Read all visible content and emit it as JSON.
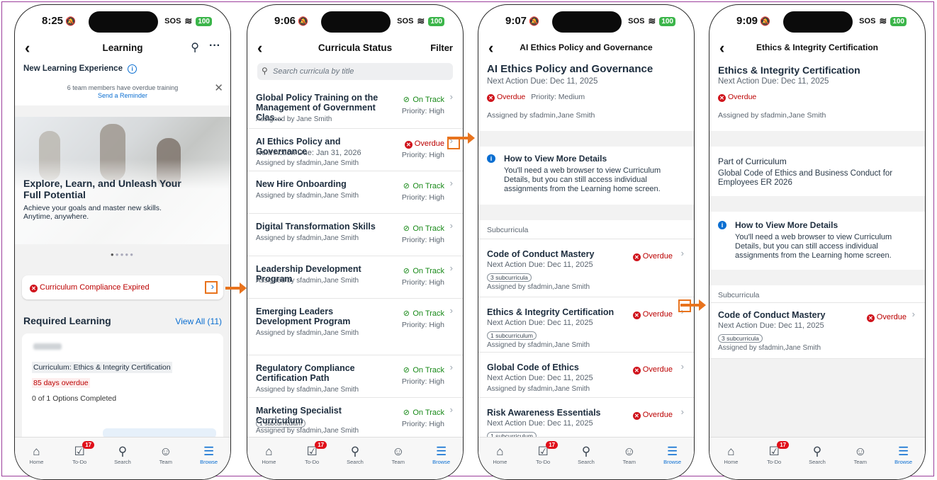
{
  "status": {
    "sos": "SOS",
    "battery": "100"
  },
  "tabs": [
    {
      "label": "Home",
      "icon": "home-icon",
      "glyph": "⌂"
    },
    {
      "label": "To-Do",
      "icon": "todo-icon",
      "glyph": "☑",
      "badge": "17"
    },
    {
      "label": "Search",
      "icon": "search-icon",
      "glyph": "⚲"
    },
    {
      "label": "Team",
      "icon": "team-icon",
      "glyph": "☺"
    },
    {
      "label": "Browse",
      "icon": "list-icon",
      "glyph": "☰"
    }
  ],
  "s1": {
    "time": "8:25",
    "title": "Learning",
    "section": "New Learning Experience",
    "banner_text": "6 team members have overdue training",
    "banner_link": "Send a Reminder",
    "hero_title": "Explore, Learn, and Unleash Your Full Potential",
    "hero_sub": "Achieve your goals and master new skills. Anytime, anywhere.",
    "alert": "Curriculum Compliance Expired",
    "req_title": "Required Learning",
    "view_all": "View All (11)",
    "card_label": "Curriculum: Ethics & Integrity Certification",
    "card_overdue": "85 days overdue",
    "card_progress": "0 of 1 Options Completed"
  },
  "s2": {
    "time": "9:06",
    "title": "Curricula Status",
    "filter": "Filter",
    "search_placeholder": "Search curricula by title",
    "items": [
      {
        "title": "Global Policy Training on the Management of Government Clas...",
        "due": "",
        "pill": "",
        "by": "Assigned by Jane Smith",
        "status": "On Track",
        "priority": "Priority: High",
        "ok": true
      },
      {
        "title": "AI Ethics Policy and Governance",
        "due": "Next Action Due: Jan 31, 2026",
        "pill": "",
        "by": "Assigned by sfadmin,Jane  Smith",
        "status": "Overdue",
        "priority": "Priority: High",
        "ok": false
      },
      {
        "title": "New Hire Onboarding",
        "due": "",
        "pill": "",
        "by": "Assigned by sfadmin,Jane  Smith",
        "status": "On Track",
        "priority": "Priority: High",
        "ok": true
      },
      {
        "title": "Digital Transformation Skills",
        "due": "",
        "pill": "",
        "by": "Assigned by sfadmin,Jane  Smith",
        "status": "On Track",
        "priority": "Priority: High",
        "ok": true
      },
      {
        "title": "Leadership Development Program",
        "due": "",
        "pill": "",
        "by": "Assigned by sfadmin,Jane  Smith",
        "status": "On Track",
        "priority": "Priority: High",
        "ok": true
      },
      {
        "title": "Emerging Leaders Development Program",
        "due": "",
        "pill": "",
        "by": "Assigned by sfadmin,Jane  Smith",
        "status": "On Track",
        "priority": "Priority: High",
        "ok": true
      },
      {
        "title": "Regulatory Compliance Certification Path",
        "due": "",
        "pill": "",
        "by": "Assigned by sfadmin,Jane  Smith",
        "status": "On Track",
        "priority": "Priority: High",
        "ok": true
      },
      {
        "title": "Marketing Specialist Curriculum",
        "due": "",
        "pill": "1 subcurriculum",
        "by": "Assigned by sfadmin,Jane  Smith",
        "status": "On Track",
        "priority": "Priority: High",
        "ok": true
      }
    ]
  },
  "s3": {
    "time": "9:07",
    "title": "AI Ethics Policy and Governance",
    "heading": "AI Ethics Policy and Governance",
    "due": "Next Action Due: Dec 11, 2025",
    "overdue": "Overdue",
    "priority": "Priority: Medium",
    "by": "Assigned by sfadmin,Jane  Smith",
    "info_title": "How to View More Details",
    "info_body": "You'll need a web browser to view Curriculum Details, but you can still access individual assignments from the Learning home screen.",
    "sub_header": "Subcurricula",
    "subs": [
      {
        "title": "Code of Conduct Mastery",
        "due": "Next Action Due: Dec 11, 2025",
        "pill": "3 subcurricula",
        "by": "Assigned by sfadmin,Jane  Smith",
        "status": "Overdue"
      },
      {
        "title": "Ethics & Integrity Certification",
        "due": "Next Action Due: Dec 11, 2025",
        "pill": "1 subcurriculum",
        "by": "Assigned by sfadmin,Jane  Smith",
        "status": "Overdue"
      },
      {
        "title": "Global Code of Ethics",
        "due": "Next Action Due: Dec 11, 2025",
        "pill": "",
        "by": "Assigned by sfadmin,Jane  Smith",
        "status": "Overdue"
      },
      {
        "title": "Risk Awareness Essentials",
        "due": "Next Action Due: Dec 11, 2025",
        "pill": "1 subcurriculum",
        "by": "",
        "status": "Overdue"
      }
    ]
  },
  "s4": {
    "time": "9:09",
    "title": "Ethics & Integrity Certification",
    "heading": "Ethics & Integrity Certification",
    "due": "Next Action Due: Dec 11, 2025",
    "overdue": "Overdue",
    "by": "Assigned by sfadmin,Jane  Smith",
    "part_label": "Part of Curriculum",
    "part_value": "Global Code of Ethics and Business Conduct for Employees ER 2026",
    "info_title": "How to View More Details",
    "info_body": "You'll need a web browser to view Curriculum Details, but you can still access individual assignments from the Learning home screen.",
    "sub_header": "Subcurricula",
    "sub": {
      "title": "Code of Conduct Mastery",
      "due": "Next Action Due: Dec 11, 2025",
      "pill": "3 subcurricula",
      "by": "Assigned by sfadmin,Jane  Smith",
      "status": "Overdue"
    }
  }
}
